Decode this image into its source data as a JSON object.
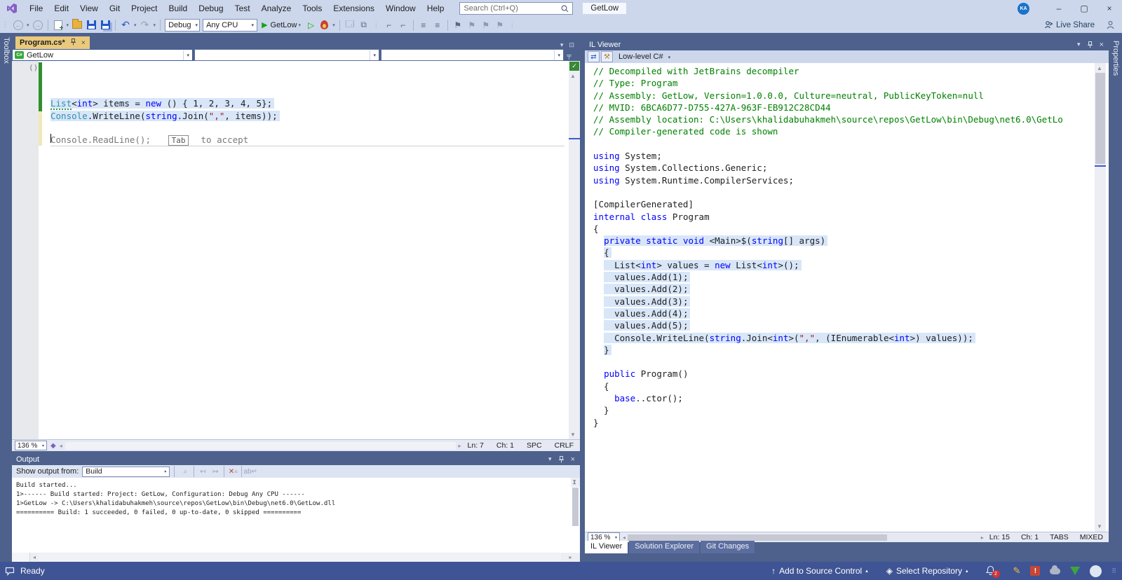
{
  "titlebar": {
    "menus": [
      "File",
      "Edit",
      "View",
      "Git",
      "Project",
      "Build",
      "Debug",
      "Test",
      "Analyze",
      "Tools",
      "Extensions",
      "Window",
      "Help"
    ],
    "search_placeholder": "Search (Ctrl+Q)",
    "solution_name": "GetLow",
    "avatar": "KA",
    "window_buttons": {
      "minimize": "–",
      "maximize": "▢",
      "close": "×"
    }
  },
  "toolbar": {
    "config_dropdown": "Debug",
    "platform_dropdown": "Any CPU",
    "run_button": "GetLow",
    "live_share": "Live Share"
  },
  "toolbox_tab": "Toolbox",
  "properties_tab": "Properties",
  "editor": {
    "tab": "Program.cs*",
    "nav_dropdown": "GetLow",
    "collapse_glyph": "()",
    "zoom": "136 %",
    "status": {
      "ln": "Ln: 7",
      "ch": "Ch: 1",
      "spc": "SPC",
      "eol": "CRLF"
    },
    "code": [
      {
        "tokens": []
      },
      {
        "tokens": []
      },
      {
        "tokens": []
      },
      {
        "hl": true,
        "tokens": [
          [
            "List",
            "ty dots"
          ],
          [
            "<",
            "pl"
          ],
          [
            "int",
            "kw"
          ],
          [
            "> items = ",
            "pl"
          ],
          [
            "new",
            "kw"
          ],
          [
            " () { 1, 2, 3, 4, 5};",
            "pl"
          ]
        ]
      },
      {
        "hl": true,
        "tokens": [
          [
            "Console",
            "ty"
          ],
          [
            ".WriteLine(",
            "pl"
          ],
          [
            "string",
            "kw"
          ],
          [
            ".Join(",
            "pl"
          ],
          [
            "\",\"",
            "str"
          ],
          [
            ", items));",
            "pl"
          ]
        ]
      },
      {
        "tokens": []
      },
      {
        "ghost": true,
        "tokens": [
          [
            "",
            "caret-bar"
          ],
          [
            "Console.ReadLine();",
            "gh"
          ],
          [
            "   ",
            "pl"
          ],
          [
            "Tab",
            "tabkey"
          ],
          [
            "  to accept",
            "gh"
          ]
        ]
      }
    ]
  },
  "il_viewer": {
    "title": "IL Viewer",
    "mode_dropdown": "Low-level C#",
    "zoom": "136 %",
    "status": {
      "ln": "Ln: 15",
      "ch": "Ch: 1",
      "tabs": "TABS",
      "mixed": "MIXED"
    },
    "bottom_tabs": [
      "IL Viewer",
      "Solution Explorer",
      "Git Changes"
    ],
    "code": [
      {
        "tokens": [
          [
            "// Decompiled with JetBrains decompiler",
            "com"
          ]
        ]
      },
      {
        "tokens": [
          [
            "// Type: Program",
            "com"
          ]
        ]
      },
      {
        "tokens": [
          [
            "// Assembly: GetLow, Version=1.0.0.0, Culture=neutral, PublicKeyToken=null",
            "com"
          ]
        ]
      },
      {
        "tokens": [
          [
            "// MVID: 6BCA6D77-D755-427A-963F-EB912C28CD44",
            "com"
          ]
        ]
      },
      {
        "tokens": [
          [
            "// Assembly location: C:\\Users\\khalidabuhakmeh\\source\\repos\\GetLow\\bin\\Debug\\net6.0\\GetLo",
            "com"
          ]
        ]
      },
      {
        "tokens": [
          [
            "// Compiler-generated code is shown",
            "com"
          ]
        ]
      },
      {
        "tokens": []
      },
      {
        "tokens": [
          [
            "using",
            "kw"
          ],
          [
            " System;",
            "pl"
          ]
        ]
      },
      {
        "tokens": [
          [
            "using",
            "kw"
          ],
          [
            " System.Collections.Generic;",
            "pl"
          ]
        ]
      },
      {
        "tokens": [
          [
            "using",
            "kw"
          ],
          [
            " System.Runtime.CompilerServices;",
            "pl"
          ]
        ]
      },
      {
        "tokens": []
      },
      {
        "tokens": [
          [
            "[CompilerGenerated]",
            "pl"
          ]
        ]
      },
      {
        "tokens": [
          [
            "internal",
            "kw"
          ],
          [
            " ",
            "pl"
          ],
          [
            "class",
            "kw"
          ],
          [
            " Program",
            "pl"
          ]
        ]
      },
      {
        "tokens": [
          [
            "{",
            "pl"
          ]
        ]
      },
      {
        "hl": true,
        "pre": "  ",
        "tokens": [
          [
            "private",
            "kw"
          ],
          [
            " ",
            "pl"
          ],
          [
            "static",
            "kw"
          ],
          [
            " ",
            "pl"
          ],
          [
            "void",
            "kw"
          ],
          [
            " <Main>$(",
            "pl"
          ],
          [
            "string",
            "kw"
          ],
          [
            "[] args)",
            "pl"
          ]
        ]
      },
      {
        "hl": true,
        "pre": "  ",
        "tokens": [
          [
            "{",
            "pl"
          ]
        ]
      },
      {
        "hl": true,
        "pre": "  ",
        "tokens": [
          [
            "  List<",
            "pl"
          ],
          [
            "int",
            "kw"
          ],
          [
            "> values = ",
            "pl"
          ],
          [
            "new",
            "kw"
          ],
          [
            " List<",
            "pl"
          ],
          [
            "int",
            "kw"
          ],
          [
            ">();",
            "pl"
          ]
        ]
      },
      {
        "hl": true,
        "pre": "  ",
        "tokens": [
          [
            "  values.Add(1);",
            "pl"
          ]
        ]
      },
      {
        "hl": true,
        "pre": "  ",
        "tokens": [
          [
            "  values.Add(2);",
            "pl"
          ]
        ]
      },
      {
        "hl": true,
        "pre": "  ",
        "tokens": [
          [
            "  values.Add(3);",
            "pl"
          ]
        ]
      },
      {
        "hl": true,
        "pre": "  ",
        "tokens": [
          [
            "  values.Add(4);",
            "pl"
          ]
        ]
      },
      {
        "hl": true,
        "pre": "  ",
        "tokens": [
          [
            "  values.Add(5);",
            "pl"
          ]
        ]
      },
      {
        "hl": true,
        "pre": "  ",
        "tokens": [
          [
            "  Console.WriteLine(",
            "pl"
          ],
          [
            "string",
            "kw"
          ],
          [
            ".Join<",
            "pl"
          ],
          [
            "int",
            "kw"
          ],
          [
            ">(",
            "pl"
          ],
          [
            "\",\"",
            "str"
          ],
          [
            ", (IEnumerable<",
            "pl"
          ],
          [
            "int",
            "kw"
          ],
          [
            ">) values));",
            "pl"
          ]
        ]
      },
      {
        "hl": true,
        "pre": "  ",
        "tokens": [
          [
            "}",
            "pl"
          ]
        ]
      },
      {
        "tokens": []
      },
      {
        "tokens": [
          [
            "  ",
            "pl"
          ],
          [
            "public",
            "kw"
          ],
          [
            " Program()",
            "pl"
          ]
        ]
      },
      {
        "tokens": [
          [
            "  {",
            "pl"
          ]
        ]
      },
      {
        "tokens": [
          [
            "    ",
            "pl"
          ],
          [
            "base",
            "kw"
          ],
          [
            "..ctor();",
            "pl"
          ]
        ]
      },
      {
        "tokens": [
          [
            "  }",
            "pl"
          ]
        ]
      },
      {
        "tokens": [
          [
            "}",
            "pl"
          ]
        ]
      }
    ]
  },
  "output": {
    "title": "Output",
    "show_output_from_label": "Show output from:",
    "source_dropdown": "Build",
    "lines": [
      "Build started...",
      "1>------ Build started: Project: GetLow, Configuration: Debug Any CPU ------",
      "1>GetLow -> C:\\Users\\khalidabuhakmeh\\source\\repos\\GetLow\\bin\\Debug\\net6.0\\GetLow.dll",
      "========== Build: 1 succeeded, 0 failed, 0 up-to-date, 0 skipped =========="
    ]
  },
  "statusbar": {
    "ready": "Ready",
    "add_to_source_control": "Add to Source Control",
    "select_repository": "Select Repository",
    "notification_count": "2"
  },
  "colors": {
    "chrome": "#4d618c",
    "menubar": "#ccd7ec",
    "statusbar": "#3f5494",
    "active_tab": "#eac97d",
    "selection": "#d8e6f8",
    "keyword": "#0000ff",
    "type": "#2b91af",
    "comment": "#008000",
    "string": "#a31515",
    "change_bar_saved": "#2f8f2f",
    "change_bar_unsaved": "#efe9b9"
  }
}
